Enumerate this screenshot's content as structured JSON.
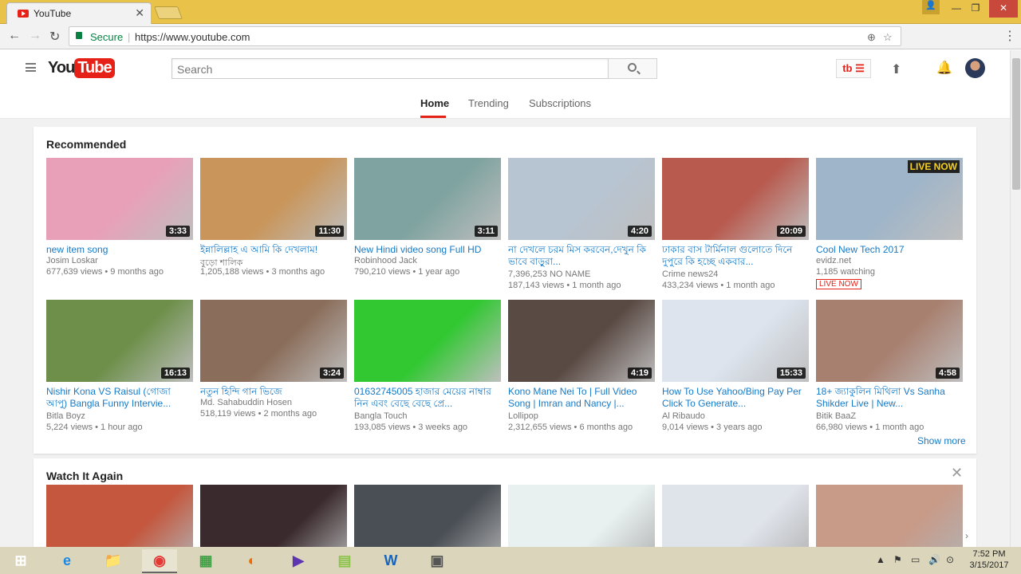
{
  "browser": {
    "tab_title": "YouTube",
    "tab_close": "✕",
    "secure_label": "Secure",
    "url_separator": "|",
    "url": "https://www.youtube.com",
    "window_controls": {
      "minimize": "—",
      "maximize": "❐",
      "close": "✕"
    },
    "nav": {
      "back": "←",
      "forward": "→",
      "reload": "↻"
    },
    "omnibox_icons": {
      "site-info": "⊕",
      "bookmark": "☆"
    }
  },
  "youtube": {
    "logo_you": "You",
    "logo_tube": "Tube",
    "search_placeholder": "Search",
    "tb_button": "tb ☰",
    "upload_icon": "⬆",
    "bell_icon": "🔔",
    "guide_tabs": [
      "Home",
      "Trending",
      "Subscriptions"
    ],
    "recommended_title": "Recommended",
    "show_more": "Show more",
    "watch_again_title": "Watch It Again",
    "close_shelf": "✕",
    "row_arrow": "›"
  },
  "recommended": [
    {
      "title": "new item song",
      "channel": "Josim Loskar",
      "meta": "677,639 views • 9 months ago",
      "duration": "3:33",
      "color": "#e8a0b8"
    },
    {
      "title": "ইন্নালিল্লাহ এ আমি কি দেখলাম!",
      "channel": "বুড়ো শালিক",
      "meta": "1,205,188 views • 3 months ago",
      "duration": "11:30",
      "color": "#c9955a"
    },
    {
      "title": "New Hindi video song Full HD",
      "channel": "Robinhood Jack",
      "meta": "790,210 views • 1 year ago",
      "duration": "3:11",
      "color": "#7fa3a0"
    },
    {
      "title": "না দেখলে চরম মিস করবেন,দেখুন কি ভাবে বাড়ুরা...",
      "channel": "7,396,253 NO NAME",
      "meta": "187,143 views • 1 month ago",
      "duration": "4:20",
      "color": "#b7c4d2"
    },
    {
      "title": "ঢাকার বাস টার্মিনাল গুলোতে দিনে দুপুরে কি হচ্ছে একবার...",
      "channel": "Crime news24",
      "meta": "433,234 views • 1 month ago",
      "duration": "20:09",
      "color": "#b85a4e"
    },
    {
      "title": "Cool New Tech 2017",
      "channel": "evidz.net",
      "meta": "1,185 watching",
      "live": "LIVE NOW",
      "live_badge": "LIVE NOW",
      "color": "#9fb5c9"
    }
  ],
  "recommended_row2": [
    {
      "title": "Nishir Kona VS Raisul (গোজা আপু) Bangla Funny Intervie...",
      "channel": "Bitla Boyz",
      "meta": "5,224 views • 1 hour ago",
      "duration": "16:13",
      "color": "#6d8f4a"
    },
    {
      "title": "নতুন হিন্দি গান ভিজে",
      "channel": "Md. Sahabuddin Hosen",
      "meta": "518,119 views • 2 months ago",
      "duration": "3:24",
      "color": "#8a6d5a"
    },
    {
      "title": "01632745005 হাজার মেয়ের নাম্বার নিন এবং বেছে বেছে প্রে...",
      "channel": "Bangla Touch",
      "meta": "193,085 views • 3 weeks ago",
      "duration": "",
      "color": "#32c832"
    },
    {
      "title": "Kono Mane Nei To | Full Video Song | Imran and Nancy |...",
      "channel": "Lollipop",
      "meta": "2,312,655 views • 6 months ago",
      "duration": "4:19",
      "color": "#5a4a44"
    },
    {
      "title": "How To Use Yahoo/Bing Pay Per Click To Generate...",
      "channel": "Al Ribaudo",
      "meta": "9,014 views • 3 years ago",
      "duration": "15:33",
      "color": "#dde4ee"
    },
    {
      "title": "18+ জ্যাকুলিন মিথিলা Vs Sanha Shikder Live | New...",
      "channel": "Bitik BaaZ",
      "meta": "66,980 views • 1 month ago",
      "duration": "4:58",
      "color": "#a88070"
    }
  ],
  "watch_again_colors": [
    "#c4573e",
    "#3a2a2e",
    "#4a4f55",
    "#e8f1f0",
    "#dfe3ea",
    "#c89a88"
  ],
  "taskbar": {
    "clock_time": "7:52 PM",
    "clock_date": "3/15/2017",
    "apps": [
      "⊞",
      "e",
      "📁",
      "◉",
      "▦",
      "◐",
      "▶",
      "▤",
      "W",
      "▣"
    ],
    "tray": [
      "▲",
      "⚑",
      "▭",
      "🔊",
      "⊙"
    ]
  }
}
